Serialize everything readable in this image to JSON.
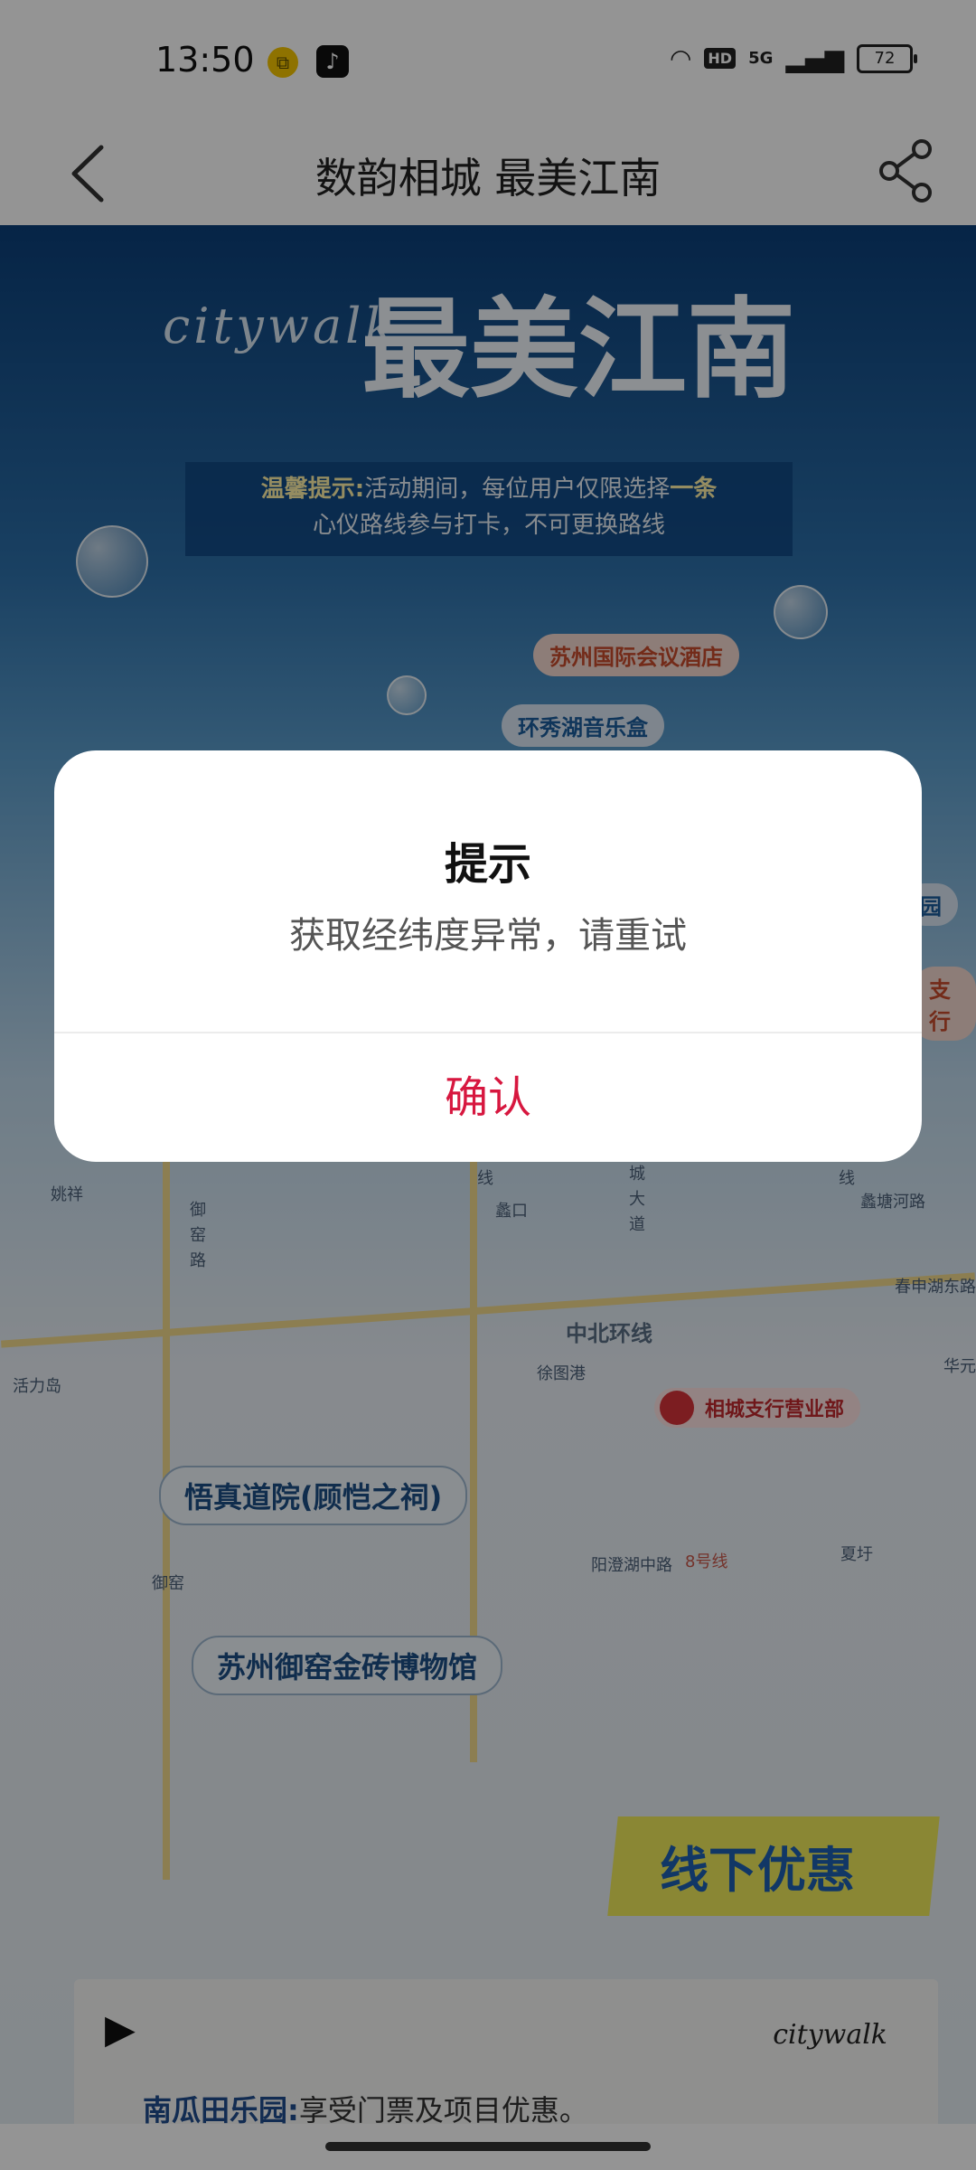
{
  "status_bar": {
    "time": "13:50",
    "hd": "HD",
    "network": "5G",
    "battery": "72"
  },
  "navbar": {
    "title": "数韵相城 最美江南"
  },
  "poster": {
    "hero_script": "citywalk",
    "hero_title": "最美江南",
    "tip_line1_prefix": "温馨提示:",
    "tip_line1_body": "活动期间，每位用户仅限选择",
    "tip_line1_emphasis": "一条",
    "tip_line2": "心仪路线参与打卡，不可更换路线",
    "poi_hotel": "苏州国际会议酒店",
    "poi_music": "环秀湖音乐盒",
    "poi_partial_1": "园",
    "poi_partial_2": "支行",
    "map_labels": {
      "yaoxiang": "姚祥",
      "yuyao_road": "御窑路",
      "lukou": "蠡口",
      "xianlu": "线",
      "chenghai": "城大道",
      "xian_right": "线",
      "lingtang": "蠡塘河路",
      "chunshen": "春申湖东路",
      "huo": "活力岛",
      "xutugang": "徐图港",
      "huayuan": "华元",
      "yangcheng": "阳澄湖中路",
      "line8": "8号线",
      "xiahang": "夏圩",
      "yuyao_station": "御窑"
    },
    "ring_road": "中北环线",
    "bank_label": "相城支行营业部",
    "landmark_1": "悟真道院(顾恺之祠)",
    "landmark_2": "苏州御窑金砖博物馆",
    "offer_text": "线下优惠",
    "card_script": "citywalk",
    "card_heading": "南瓜田乐园:",
    "card_body": "享受门票及项目优惠。"
  },
  "dialog": {
    "title": "提示",
    "message": "获取经纬度异常，请重试",
    "confirm_label": "确认"
  },
  "colors": {
    "accent_red": "#d7173f",
    "overlay": "rgba(0,0,0,0.42)"
  }
}
